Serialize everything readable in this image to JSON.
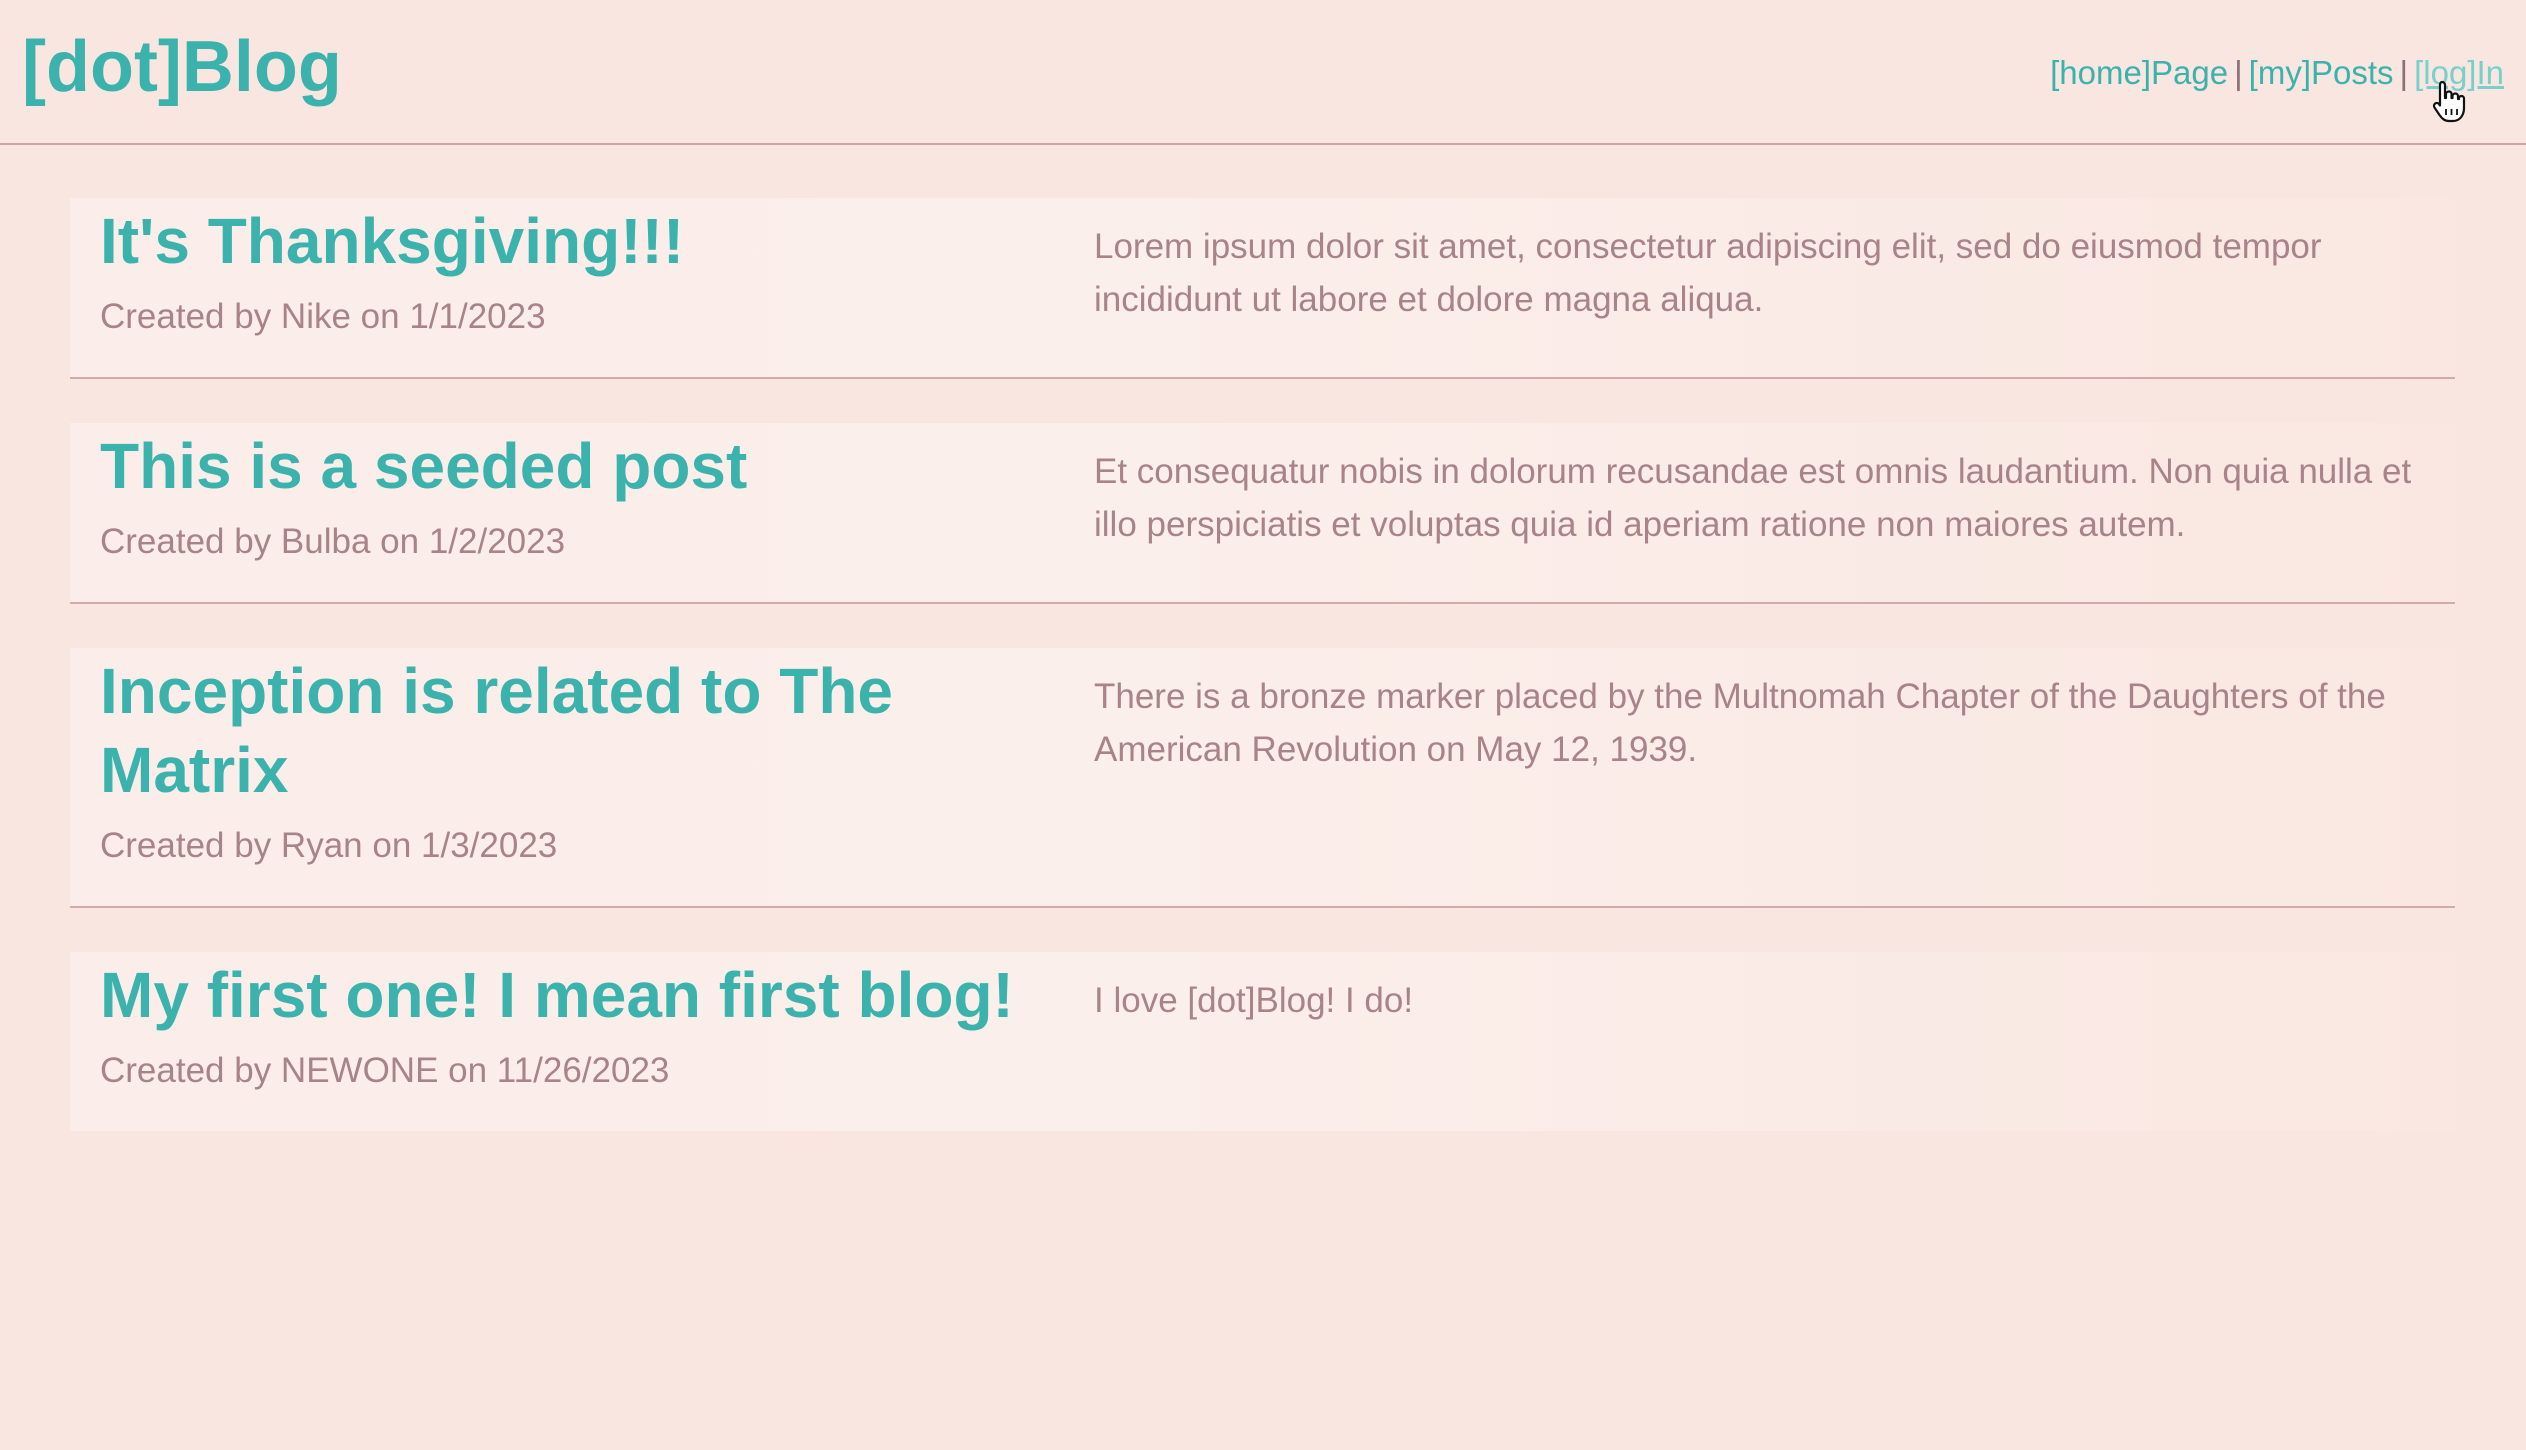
{
  "header": {
    "logo": "[dot]Blog",
    "nav": {
      "home_label": "[home]Page",
      "separator": "|",
      "my_posts_label": "[my]Posts",
      "login_label": "[log]In"
    }
  },
  "posts": [
    {
      "title": "It's Thanksgiving!!!",
      "meta": "Created by Nike on 1/1/2023",
      "body": "Lorem ipsum dolor sit amet, consectetur adipiscing elit, sed do eiusmod tempor incididunt ut labore et dolore magna aliqua."
    },
    {
      "title": "This is a seeded post",
      "meta": "Created by Bulba on 1/2/2023",
      "body": "Et consequatur nobis in dolorum recusandae est omnis laudantium. Non quia nulla et illo perspiciatis et voluptas quia id aperiam ratione non maiores autem."
    },
    {
      "title": "Inception is related to The Matrix",
      "meta": "Created by Ryan on 1/3/2023",
      "body": "There is a bronze marker placed by the Multnomah Chapter of the Daughters of the American Revolution on May 12, 1939."
    },
    {
      "title": "My first one! I mean first blog!",
      "meta": "Created by NEWONE on 11/26/2023",
      "body": "I love [dot]Blog! I do!"
    }
  ],
  "colors": {
    "background": "#f9e6e0",
    "accent": "#3cb2ac",
    "muted_text": "#a9838a",
    "divider": "#d4a9ab"
  },
  "icons": {
    "cursor": "hand-pointer-icon"
  }
}
